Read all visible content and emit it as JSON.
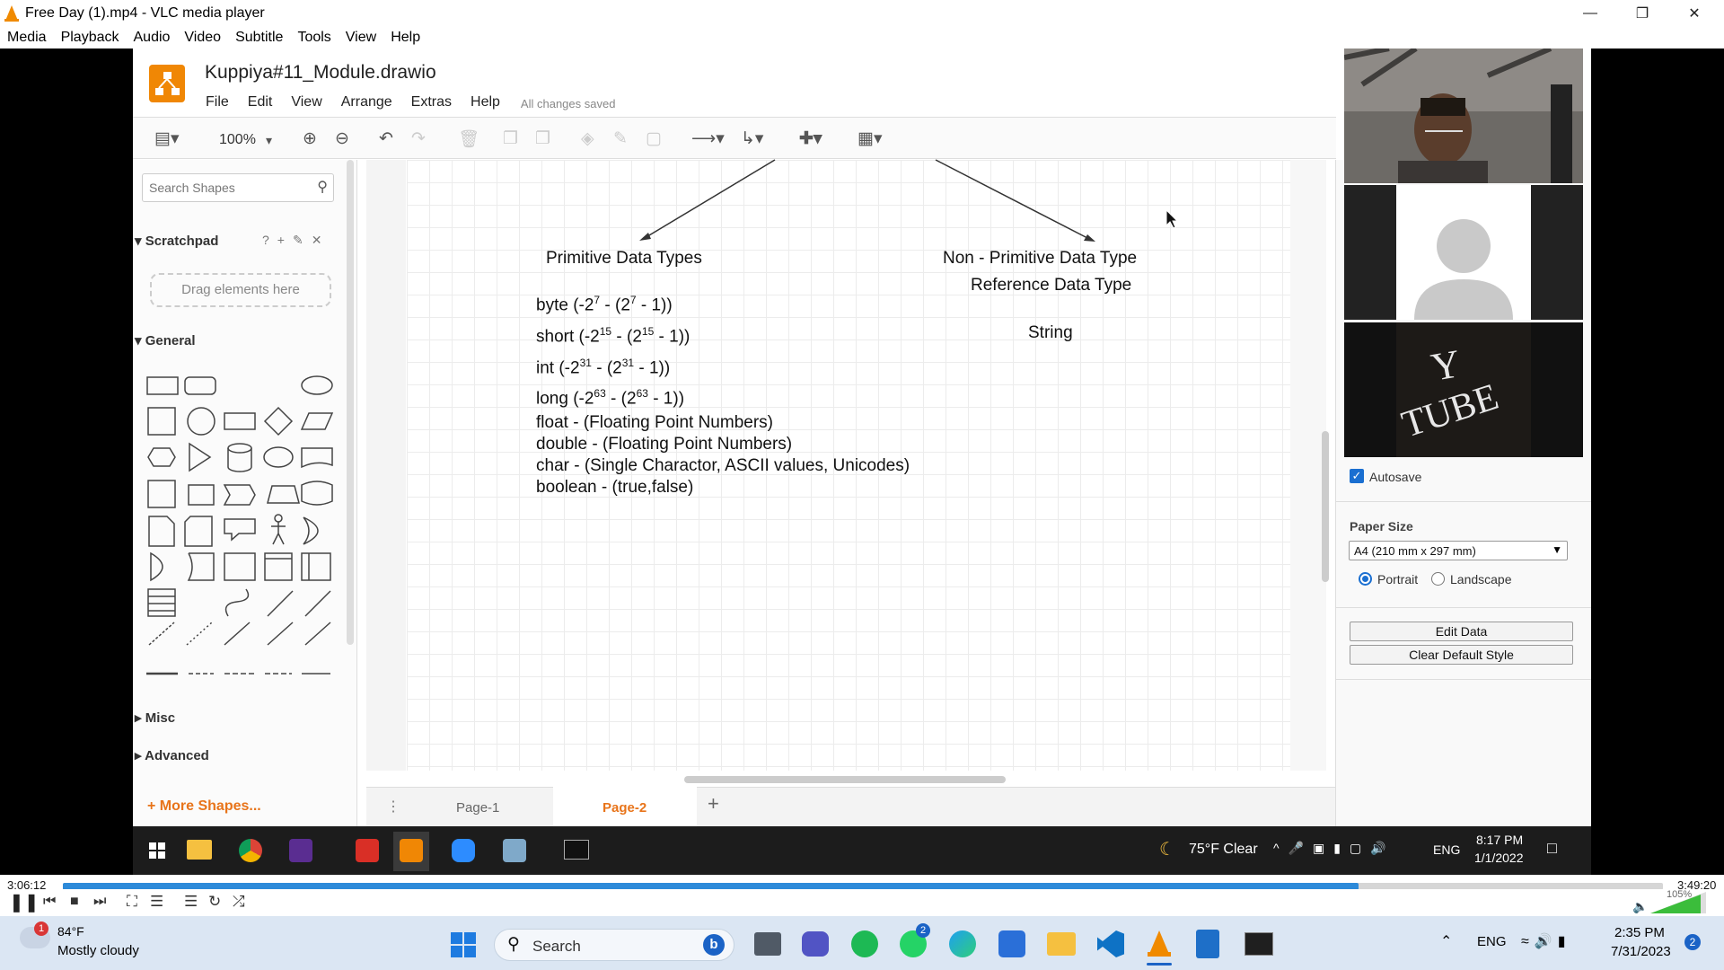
{
  "window": {
    "title": "Free Day (1).mp4 - VLC media player"
  },
  "vlc_menu": [
    "Media",
    "Playback",
    "Audio",
    "Video",
    "Subtitle",
    "Tools",
    "View",
    "Help"
  ],
  "drawio": {
    "filename": "Kuppiya#11_Module.drawio",
    "menu": [
      "File",
      "Edit",
      "View",
      "Arrange",
      "Extras",
      "Help"
    ],
    "status": "All changes saved",
    "zoom": "100%",
    "search_placeholder": "Search Shapes",
    "scratchpad": "Scratchpad",
    "drag_hint": "Drag elements here",
    "general": "General",
    "misc": "Misc",
    "advanced": "Advanced",
    "more_shapes": "More Shapes...",
    "pages": [
      "Page-1",
      "Page-2"
    ],
    "autosave": "Autosave",
    "paper_size_label": "Paper Size",
    "paper_size_value": "A4 (210 mm x 297 mm)",
    "portrait": "Portrait",
    "landscape": "Landscape",
    "edit_data": "Edit Data",
    "clear_style": "Clear Default Style"
  },
  "diagram": {
    "primitive_title": "Primitive Data Types",
    "non_primitive_title": "Non - Primitive Data Type",
    "reference_title": "Reference Data Type",
    "string": "String",
    "items": [
      {
        "pre": "byte (-2",
        "e1": "7",
        "mid": " - (2",
        "e2": "7",
        "post": " - 1))"
      },
      {
        "pre": "short (-2",
        "e1": "15",
        "mid": " - (2",
        "e2": "15",
        "post": " - 1))"
      },
      {
        "pre": "int (-2",
        "e1": "31",
        "mid": " - (2",
        "e2": "31",
        "post": " - 1))"
      },
      {
        "pre": "long (-2",
        "e1": "63",
        "mid": " - (2",
        "e2": "63",
        "post": " - 1))"
      }
    ],
    "lines": [
      "float - (Floating Point Numbers)",
      "double - (Floating Point Numbers)",
      "char - (Single Charactor, ASCII values, Unicodes)",
      "boolean - (true,false)"
    ]
  },
  "inner_taskbar": {
    "weather": "75°F  Clear",
    "lang": "ENG",
    "time": "8:17 PM",
    "date": "1/1/2022"
  },
  "player": {
    "elapsed": "3:06:12",
    "total": "3:49:20",
    "progress": 0.81,
    "volume": "105%"
  },
  "taskbar": {
    "temp": "84°F",
    "weather": "Mostly cloudy",
    "badge": "1",
    "search": "Search",
    "lang": "ENG",
    "time": "2:35 PM",
    "date": "7/31/2023",
    "notif": "2",
    "whatsapp_badge": "2"
  },
  "webcam": {
    "text1": "Y",
    "text2": "TUBE"
  }
}
